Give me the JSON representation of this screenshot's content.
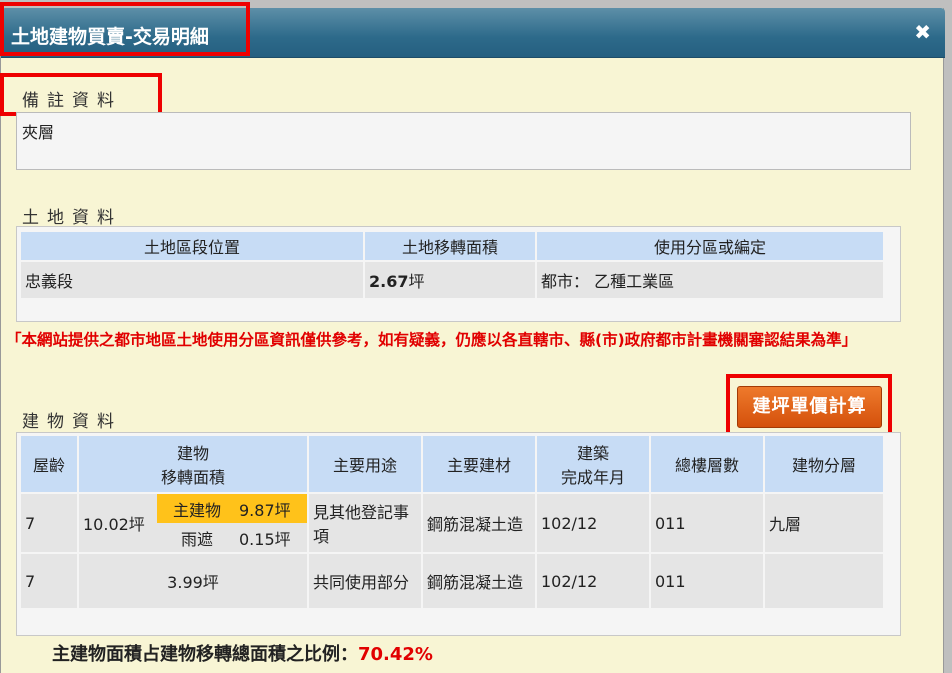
{
  "dialog": {
    "title": "土地建物買賣-交易明細",
    "close_symbol": "✖"
  },
  "notes": {
    "label": "備註資料",
    "content": "夾層"
  },
  "land": {
    "label": "土地資料",
    "headers": [
      "土地區段位置",
      "土地移轉面積",
      "使用分區或編定"
    ],
    "row": {
      "location": "忠義段",
      "area_value": "2.67",
      "area_unit": "坪",
      "zoning": "都市： 乙種工業區"
    }
  },
  "warning": "「本網站提供之都市地區土地使用分區資訊僅供參考，如有疑義，仍應以各直轄市、縣(市)政府都市計畫機關審認結果為準」",
  "building": {
    "label": "建物資料",
    "calc_button": "建坪單價計算",
    "headers": {
      "age": "屋齡",
      "area_line1": "建物",
      "area_line2": "移轉面積",
      "use": "主要用途",
      "material": "主要建材",
      "built_line1": "建築",
      "built_line2": "完成年月",
      "floors": "總樓層數",
      "level": "建物分層"
    },
    "rows": [
      {
        "age": "7",
        "total_area": "10.02坪",
        "sub": [
          {
            "name": "主建物",
            "value": "9.87坪"
          },
          {
            "name": "雨遮",
            "value": "0.15坪"
          }
        ],
        "use": "見其他登記事項",
        "material": "鋼筋混凝土造",
        "built": "102/12",
        "floors": "011",
        "level": "九層"
      },
      {
        "age": "7",
        "total_area": "3.99坪",
        "use": "共同使用部分",
        "material": "鋼筋混凝土造",
        "built": "102/12",
        "floors": "011",
        "level": ""
      }
    ]
  },
  "ratio": {
    "label": "主建物面積占建物移轉總面積之比例：",
    "value": "70.42%"
  },
  "colors": {
    "highlight_border": "#ee0000",
    "warning_text": "#e10000",
    "header_bg": "#c7dcf5",
    "main_building_highlight": "#ffc21a",
    "calc_button": "#e0621b"
  }
}
